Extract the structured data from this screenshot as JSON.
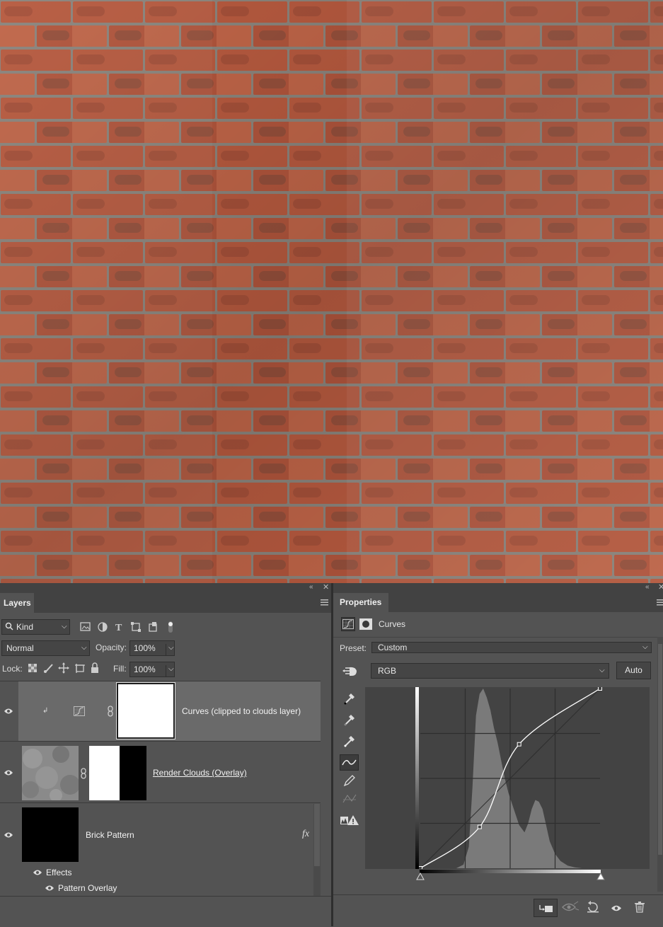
{
  "layers_panel": {
    "title": "Layers",
    "filter_kind": "Kind",
    "blend_mode": "Normal",
    "opacity_label": "Opacity:",
    "opacity_value": "100%",
    "lock_label": "Lock:",
    "fill_label": "Fill:",
    "fill_value": "100%",
    "layers": [
      {
        "name": "Curves (clipped to clouds layer)"
      },
      {
        "name": "Render Clouds (Overlay)"
      },
      {
        "name": "Brick Pattern",
        "fx": "fx"
      }
    ],
    "effects_label": "Effects",
    "effect_items": [
      "Pattern Overlay"
    ]
  },
  "properties_panel": {
    "title": "Properties",
    "adjustment_name": "Curves",
    "preset_label": "Preset:",
    "preset_value": "Custom",
    "channel": "RGB",
    "auto_label": "Auto",
    "curve_points": [
      [
        0,
        0
      ],
      [
        0.33,
        0.23
      ],
      [
        0.55,
        0.69
      ],
      [
        1,
        1
      ]
    ]
  },
  "icons": [
    "collapse-icon",
    "close-icon",
    "panel-menu-icon",
    "search-icon",
    "eye-icon",
    "link-icon",
    "clip-icon",
    "eyedropper-icon",
    "pencil-icon",
    "curve-tool-icon",
    "trash-icon"
  ],
  "colors": {
    "panel_bg": "#535353",
    "dark_bg": "#424242",
    "selected_layer": "#6a6a6a",
    "brick": "#b85a40",
    "mortar": "#8a837c"
  }
}
